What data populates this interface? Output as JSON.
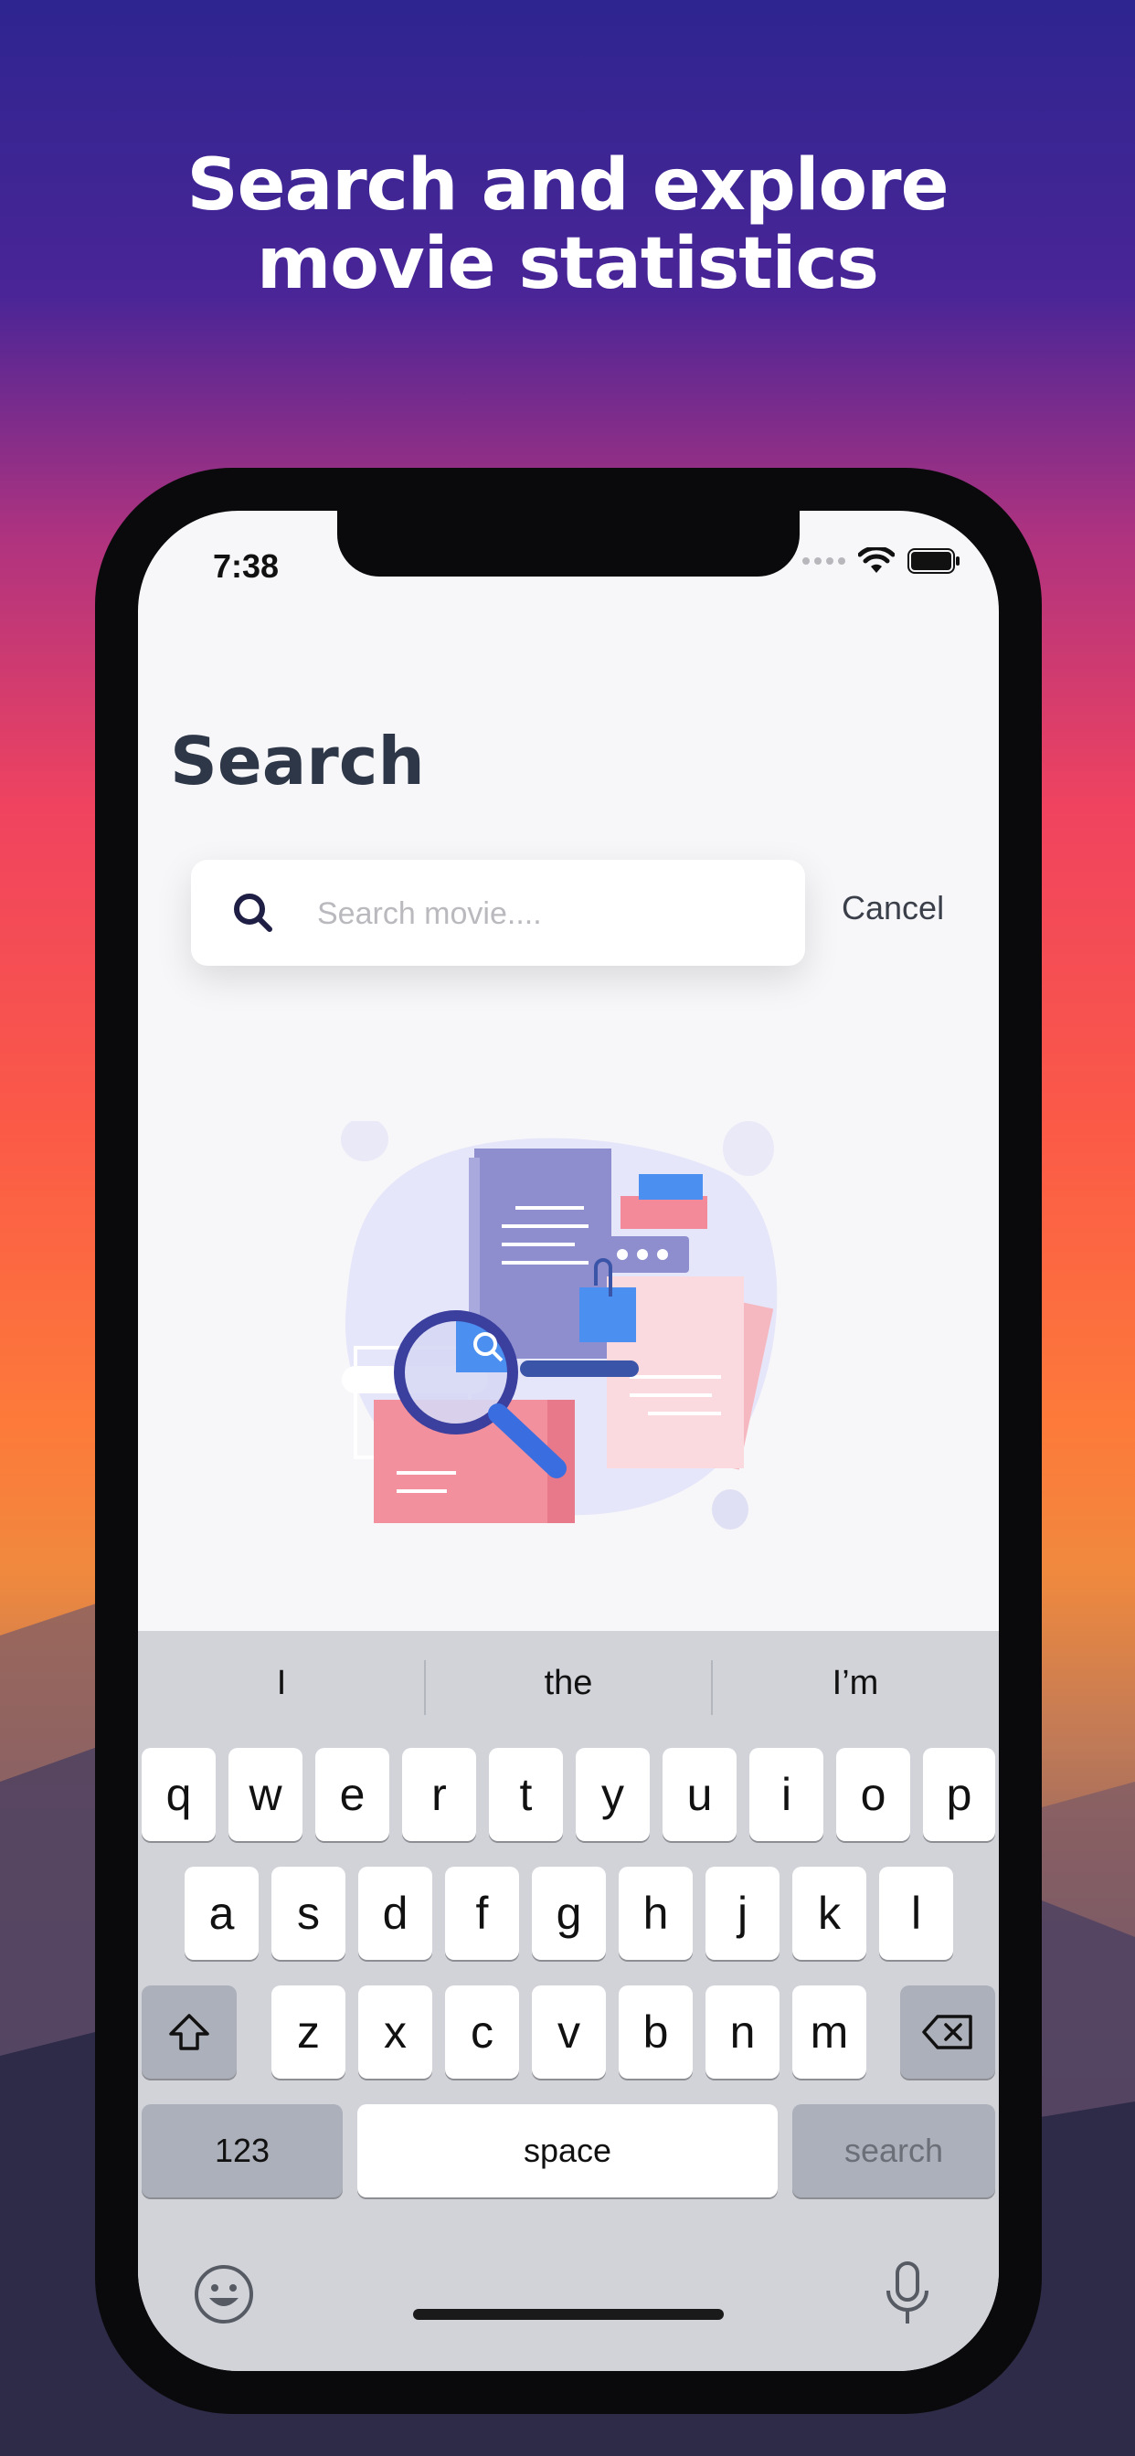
{
  "headline": {
    "line1": "Search and explore",
    "line2": "movie statistics"
  },
  "status_bar": {
    "time": "7:38"
  },
  "page": {
    "title": "Search"
  },
  "search": {
    "placeholder": "Search movie....",
    "value": "",
    "cancel_label": "Cancel"
  },
  "keyboard": {
    "suggestions": [
      "I",
      "the",
      "I’m"
    ],
    "row1": [
      "q",
      "w",
      "e",
      "r",
      "t",
      "y",
      "u",
      "i",
      "o",
      "p"
    ],
    "row2": [
      "a",
      "s",
      "d",
      "f",
      "g",
      "h",
      "j",
      "k",
      "l"
    ],
    "row3": [
      "z",
      "x",
      "c",
      "v",
      "b",
      "n",
      "m"
    ],
    "numbers_label": "123",
    "space_label": "space",
    "search_label": "search"
  },
  "colors": {
    "title": "#2e3747",
    "search_icon": "#1f1f45",
    "keyboard_bg": "#d1d3d9",
    "accent_blue": "#4b8ff0",
    "illustration_purple": "#8e8ecf",
    "illustration_pink": "#f0a0a8"
  },
  "icons": [
    "search-icon",
    "wifi-icon",
    "battery-icon",
    "shift-icon",
    "backspace-icon",
    "emoji-icon",
    "microphone-icon"
  ]
}
